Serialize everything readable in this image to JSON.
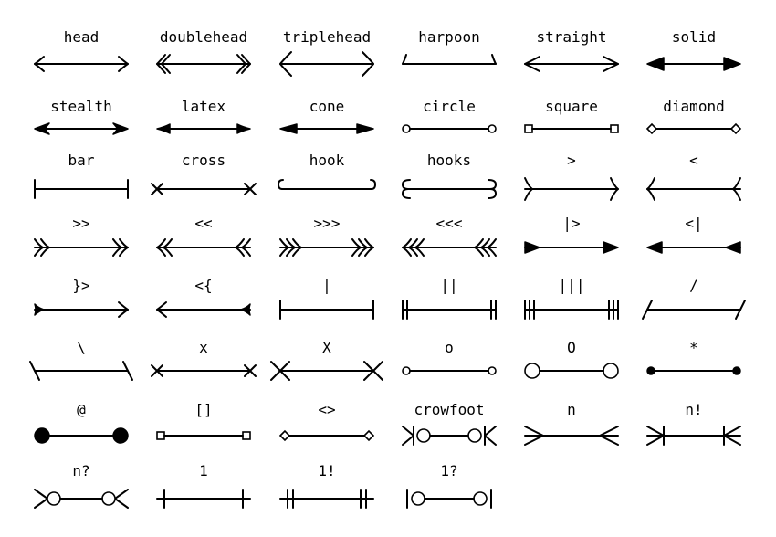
{
  "arrows": [
    {
      "label": "head",
      "style": "head"
    },
    {
      "label": "doublehead",
      "style": "doublehead"
    },
    {
      "label": "triplehead",
      "style": "triplehead"
    },
    {
      "label": "harpoon",
      "style": "harpoon"
    },
    {
      "label": "straight",
      "style": "straight"
    },
    {
      "label": "solid",
      "style": "solid"
    },
    {
      "label": "stealth",
      "style": "stealth"
    },
    {
      "label": "latex",
      "style": "latex"
    },
    {
      "label": "cone",
      "style": "cone"
    },
    {
      "label": "circle",
      "style": "circle"
    },
    {
      "label": "square",
      "style": "square"
    },
    {
      "label": "diamond",
      "style": "diamond"
    },
    {
      "label": "bar",
      "style": "bar"
    },
    {
      "label": "cross",
      "style": "cross"
    },
    {
      "label": "hook",
      "style": "hook"
    },
    {
      "label": "hooks",
      "style": "hooks"
    },
    {
      "label": ">",
      "style": "gt"
    },
    {
      "label": "<",
      "style": "lt"
    },
    {
      "label": ">>",
      "style": "gtgt"
    },
    {
      "label": "<<",
      "style": "ltlt"
    },
    {
      "label": ">>>",
      "style": "gt3"
    },
    {
      "label": "<<<",
      "style": "lt3"
    },
    {
      "label": "|>",
      "style": "bartri"
    },
    {
      "label": "<|",
      "style": "tribar"
    },
    {
      "label": "}>",
      "style": "brace"
    },
    {
      "label": "<{",
      "style": "brace-rev"
    },
    {
      "label": "|",
      "style": "vbar"
    },
    {
      "label": "||",
      "style": "vbar2"
    },
    {
      "label": "|||",
      "style": "vbar3"
    },
    {
      "label": "/",
      "style": "slash"
    },
    {
      "label": "\\",
      "style": "backslash"
    },
    {
      "label": "x",
      "style": "x"
    },
    {
      "label": "X",
      "style": "bigx"
    },
    {
      "label": "o",
      "style": "o"
    },
    {
      "label": "O",
      "style": "bigo"
    },
    {
      "label": "*",
      "style": "star"
    },
    {
      "label": "@",
      "style": "at"
    },
    {
      "label": "[]",
      "style": "box"
    },
    {
      "label": "<>",
      "style": "diam"
    },
    {
      "label": "crowfoot",
      "style": "crowfoot"
    },
    {
      "label": "n",
      "style": "n"
    },
    {
      "label": "n!",
      "style": "nbang"
    },
    {
      "label": "n?",
      "style": "nq"
    },
    {
      "label": "1",
      "style": "one"
    },
    {
      "label": "1!",
      "style": "onebang"
    },
    {
      "label": "1?",
      "style": "oneq"
    }
  ]
}
